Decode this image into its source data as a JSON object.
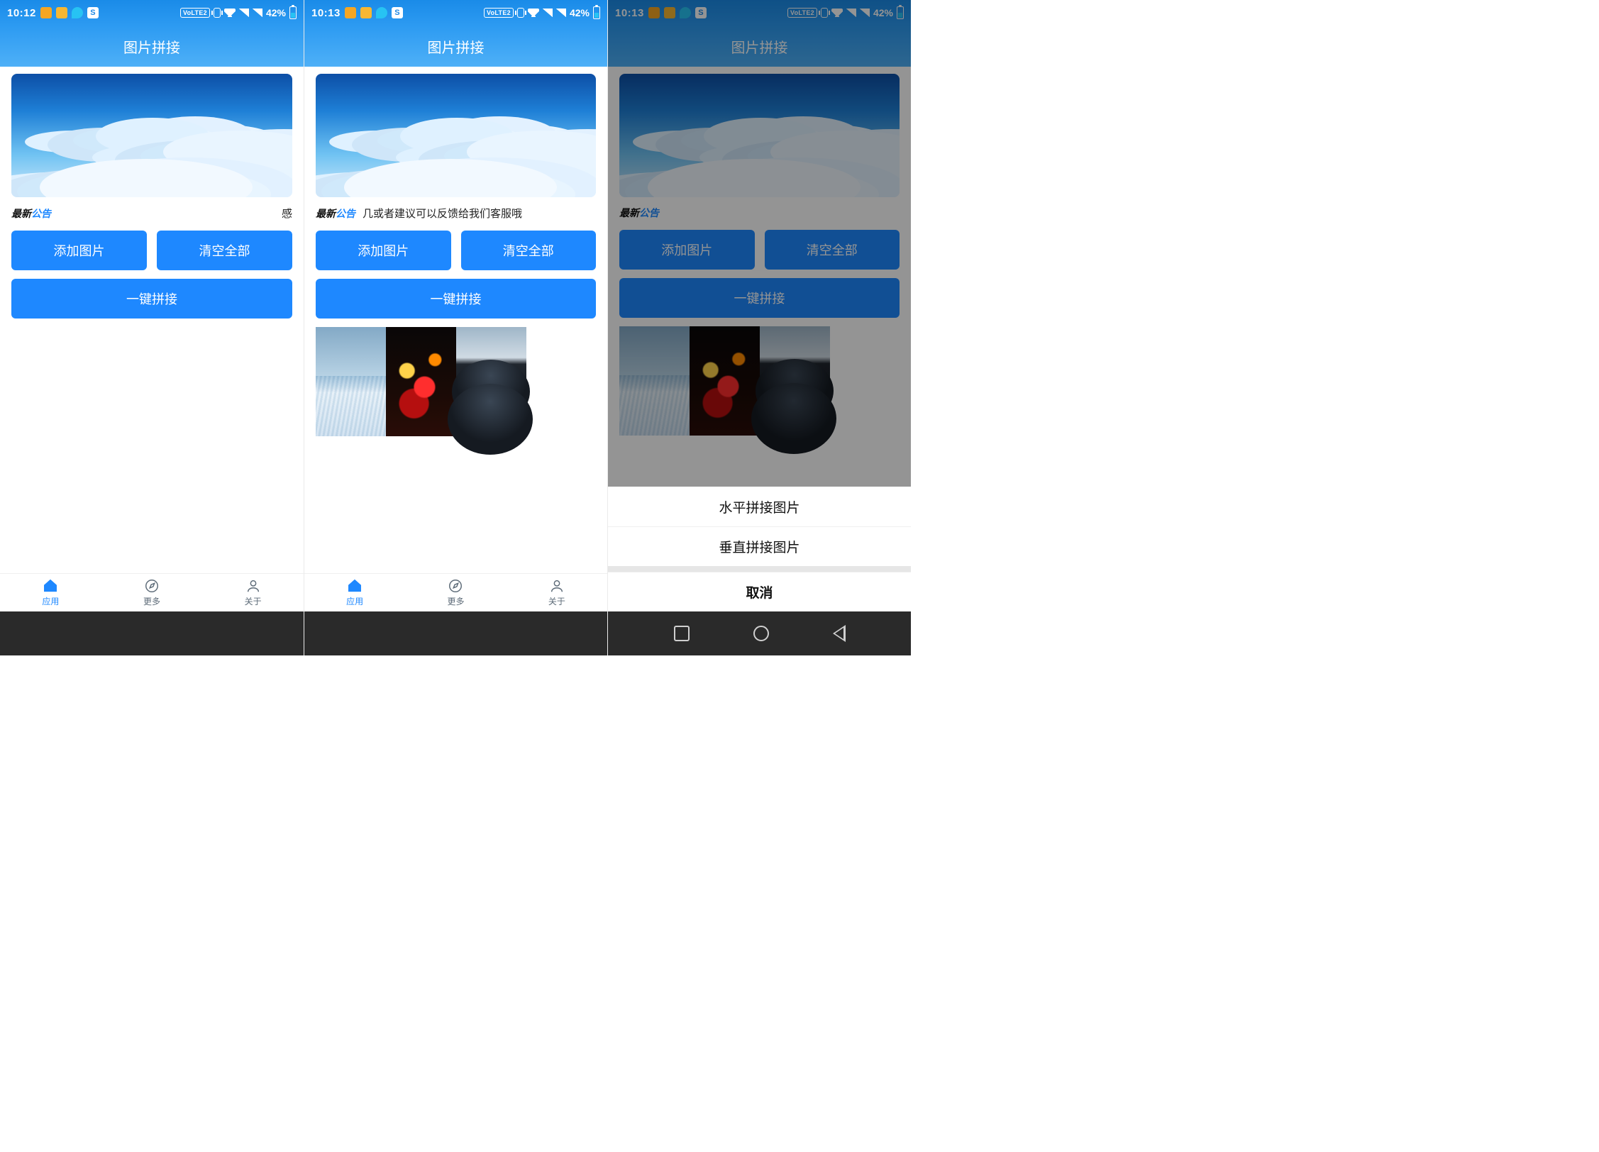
{
  "screens": [
    {
      "statusbar": {
        "time": "10:12",
        "battery": "42%"
      },
      "announce_msg": "感"
    },
    {
      "statusbar": {
        "time": "10:13",
        "battery": "42%"
      },
      "announce_msg": "几或者建议可以反馈给我们客服哦"
    },
    {
      "statusbar": {
        "time": "10:13",
        "battery": "42%"
      },
      "announce_msg": ""
    }
  ],
  "volte": "VoLTE2",
  "s_glyph": "S",
  "app": {
    "title": "图片拼接"
  },
  "announce_tag": {
    "a": "最新",
    "b": "公告"
  },
  "buttons": {
    "add": "添加图片",
    "clear": "清空全部",
    "stitch": "一键拼接"
  },
  "tabs": {
    "app": "应用",
    "more": "更多",
    "about": "关于"
  },
  "sheet": {
    "horizontal": "水平拼接图片",
    "vertical": "垂直拼接图片",
    "cancel": "取消"
  }
}
